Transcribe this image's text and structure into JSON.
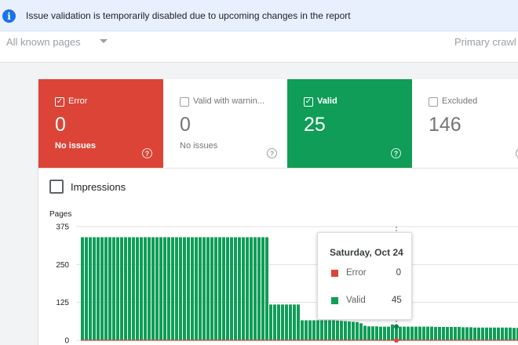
{
  "banner": {
    "message": "Issue validation is temporarily disabled due to upcoming changes in the report"
  },
  "filters": {
    "pages_filter": "All known pages",
    "crawler_filter": "Primary crawl"
  },
  "status_cards": {
    "error": {
      "title": "Error",
      "count": "0",
      "subtitle": "No issues",
      "checked": true,
      "color": "#db4437"
    },
    "warning": {
      "title": "Valid with warnin...",
      "count": "0",
      "subtitle": "No issues",
      "checked": false
    },
    "valid": {
      "title": "Valid",
      "count": "25",
      "checked": true,
      "color": "#0f9d58"
    },
    "excluded": {
      "title": "Excluded",
      "count": "146",
      "checked": false
    }
  },
  "impressions": {
    "label": "Impressions",
    "checked": false
  },
  "chart_data": {
    "type": "bar",
    "ylabel": "Pages",
    "yticks": [
      "375",
      "250",
      "125",
      "0"
    ],
    "ylim": [
      0,
      375
    ],
    "series": [
      {
        "name": "Valid",
        "color": "#0f9d58",
        "values": [
          340,
          340,
          340,
          340,
          340,
          340,
          340,
          340,
          340,
          340,
          340,
          340,
          340,
          340,
          340,
          340,
          340,
          340,
          340,
          340,
          340,
          340,
          340,
          340,
          340,
          340,
          340,
          340,
          340,
          340,
          340,
          340,
          340,
          340,
          340,
          340,
          340,
          340,
          340,
          340,
          340,
          340,
          340,
          340,
          340,
          340,
          340,
          340,
          118,
          118,
          118,
          118,
          118,
          118,
          118,
          118,
          66,
          66,
          66,
          66,
          66,
          66,
          66,
          66,
          66,
          65,
          64,
          63,
          62,
          61,
          60,
          56,
          48,
          46,
          46,
          46,
          45,
          45,
          45,
          52,
          45,
          45,
          45,
          45,
          45,
          45,
          45,
          45,
          45,
          45,
          44,
          44,
          44,
          44,
          44,
          44,
          44,
          43,
          43,
          43,
          42,
          42,
          42,
          42,
          42,
          42,
          42,
          42,
          42,
          42,
          41,
          41,
          41,
          41,
          41,
          41,
          41,
          40,
          40,
          40,
          40,
          40,
          40,
          40,
          40,
          40,
          40,
          40,
          40,
          40,
          40,
          40,
          40,
          40,
          40,
          40,
          39,
          39,
          39,
          39,
          39,
          39,
          39,
          39,
          39,
          39,
          39,
          39,
          39,
          39,
          38,
          38,
          38,
          38,
          38,
          38,
          38,
          38,
          38,
          38,
          38,
          38,
          38,
          38,
          38,
          38,
          38,
          38,
          38,
          38,
          38,
          38,
          38,
          38,
          38,
          38,
          38
        ]
      },
      {
        "name": "Error",
        "color": "#db4437",
        "values": []
      }
    ],
    "selected_index": 80,
    "tooltip": {
      "date": "Saturday, Oct 24",
      "rows": [
        {
          "name": "Error",
          "value": "0",
          "color": "#db4437"
        },
        {
          "name": "Valid",
          "value": "45",
          "color": "#0f9d58"
        }
      ]
    },
    "grid": true
  }
}
